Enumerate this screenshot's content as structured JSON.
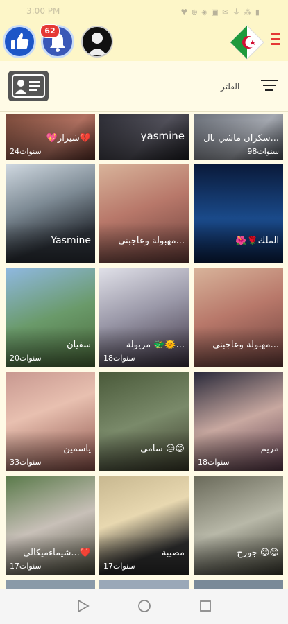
{
  "status_bar": {
    "time": "3:00 PM",
    "icons": "♥ ⊛ ◈ ▣ ✉ ⏚ ⁂ ▮"
  },
  "topbar": {
    "notification_count": "62"
  },
  "filter": {
    "label": "الفلتر"
  },
  "profiles": [
    {
      "name": "💖شيراز💔",
      "age": "24سنوات"
    },
    {
      "name": "yasmine",
      "age": ""
    },
    {
      "name": "سكران ماشي بال...",
      "age": "98سنوات"
    },
    {
      "name": "Yasmine",
      "age": ""
    },
    {
      "name": "مهبولة وعاجبني...",
      "age": ""
    },
    {
      "name": "🌺🌹الملك",
      "age": ""
    },
    {
      "name": "سفيان",
      "age": "20سنوات"
    },
    {
      "name": "مريولة 🐲🌞...",
      "age": "18سنوات"
    },
    {
      "name": "مهبولة وعاجبني...",
      "age": ""
    },
    {
      "name": "ياسمين",
      "age": "33سنوات"
    },
    {
      "name": "سامي 😑😊",
      "age": ""
    },
    {
      "name": "مريم",
      "age": "18سنوات"
    },
    {
      "name": "شيماءميكالي...❤️",
      "age": "17سنوات"
    },
    {
      "name": "مصيبة",
      "age": "17سنوات"
    },
    {
      "name": "جورج 😊😊",
      "age": ""
    }
  ],
  "colors": {
    "accent_red": "#e53935",
    "topbar_bg": "#fdf6c8",
    "like_blue": "#1d56c7"
  }
}
